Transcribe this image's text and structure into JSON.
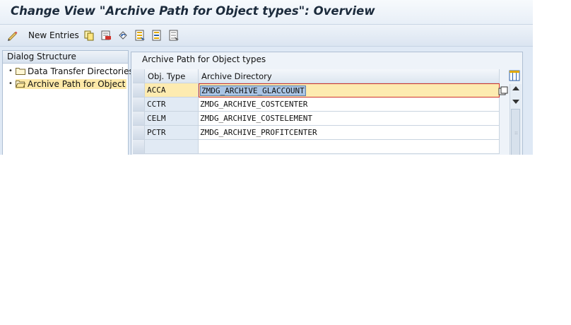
{
  "window": {
    "title": "Change View \"Archive Path for Object types\": Overview"
  },
  "toolbar": {
    "new_entries_label": "New Entries"
  },
  "dialog_structure": {
    "header": "Dialog Structure",
    "items": [
      {
        "label": "Data Transfer Directories",
        "selected": false
      },
      {
        "label": "Archive Path for Object",
        "selected": true
      }
    ]
  },
  "table": {
    "group_title": "Archive Path for Object types",
    "columns": [
      "Obj. Type",
      "Archive Directory"
    ],
    "rows": [
      {
        "obj_type": "ACCA",
        "archive_directory": "ZMDG_ARCHIVE_GLACCOUNT",
        "selected": true
      },
      {
        "obj_type": "CCTR",
        "archive_directory": "ZMDG_ARCHIVE_COSTCENTER",
        "selected": false
      },
      {
        "obj_type": "CELM",
        "archive_directory": "ZMDG_ARCHIVE_COSTELEMENT",
        "selected": false
      },
      {
        "obj_type": "PCTR",
        "archive_directory": "ZMDG_ARCHIVE_PROFITCENTER",
        "selected": false
      }
    ]
  },
  "colors": {
    "selection_row": "#fdebb0",
    "frame_bg": "#dfe9f5",
    "accent": "#2a5da8"
  }
}
